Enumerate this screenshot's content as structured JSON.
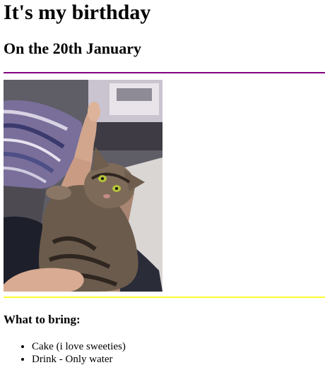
{
  "header": {
    "title": "It's my birthday",
    "subtitle": "On the 20th January"
  },
  "colors": {
    "top_rule": "#800080",
    "bottom_rule": "#ffff33"
  },
  "photo": {
    "subject": "tabby-cat-on-lap"
  },
  "bring": {
    "heading": "What to bring:",
    "items": [
      "Cake (i love sweeties)",
      "Drink - Only water"
    ]
  }
}
